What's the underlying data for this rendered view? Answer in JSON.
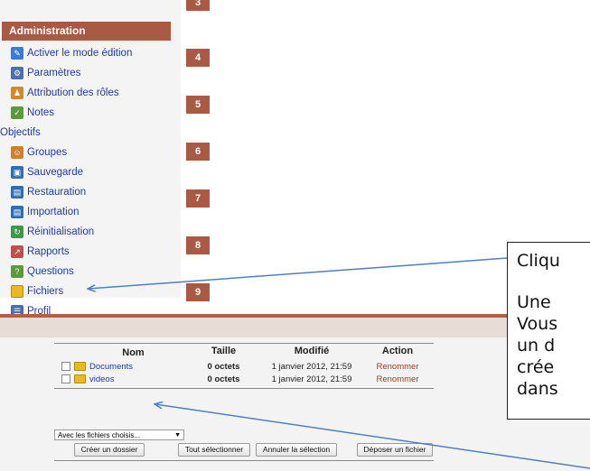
{
  "admin": {
    "title": "Administration",
    "items": [
      {
        "label": "Activer le mode édition",
        "icon": "edit-pencil-icon",
        "color": "#3a7bd5"
      },
      {
        "label": "Paramètres",
        "icon": "settings-icon",
        "color": "#4a6fb0"
      },
      {
        "label": "Attribution des rôles",
        "icon": "roles-icon",
        "color": "#d08a2a"
      },
      {
        "label": "Notes",
        "icon": "grades-icon",
        "color": "#5a9a3a"
      },
      {
        "label": "Objectifs",
        "icon": "",
        "color": ""
      },
      {
        "label": "Groupes",
        "icon": "groups-icon",
        "color": "#d0802a"
      },
      {
        "label": "Sauvegarde",
        "icon": "backup-icon",
        "color": "#2f6db5"
      },
      {
        "label": "Restauration",
        "icon": "restore-icon",
        "color": "#2f6db5"
      },
      {
        "label": "Importation",
        "icon": "import-icon",
        "color": "#2f6db5"
      },
      {
        "label": "Réinitialisation",
        "icon": "reset-icon",
        "color": "#3a9a4a"
      },
      {
        "label": "Rapports",
        "icon": "reports-icon",
        "color": "#c0504d"
      },
      {
        "label": "Questions",
        "icon": "questions-icon",
        "color": "#5a9a3a"
      },
      {
        "label": "Fichiers",
        "icon": "folder-icon",
        "color": "#e8b923"
      },
      {
        "label": "Profil",
        "icon": "profile-icon",
        "color": "#4a6fb0"
      }
    ]
  },
  "weeks": [
    "3",
    "4",
    "5",
    "6",
    "7",
    "8",
    "9"
  ],
  "files": {
    "headers": {
      "name": "Nom",
      "size": "Taille",
      "modified": "Modifié",
      "action": "Action"
    },
    "rows": [
      {
        "name": "Documents",
        "size": "0 octets",
        "modified": "1 janvier 2012, 21:59",
        "action": "Renommer"
      },
      {
        "name": "videos",
        "size": "0 octets",
        "modified": "1 janvier 2012, 21:59",
        "action": "Renommer"
      }
    ],
    "with_selected": "Avec les fichiers choisis...",
    "buttons": {
      "create_folder": "Créer un dossier",
      "select_all": "Tout sélectionner",
      "deselect": "Annuler la sélection",
      "upload": "Déposer un fichier"
    }
  },
  "callout": {
    "lines": [
      "Cliqu",
      "",
      "Une",
      "Vous",
      "un d",
      "crée",
      "dans"
    ]
  },
  "colors": {
    "accent": "#a85a45",
    "link": "#1f3aa8",
    "arrow": "#4f7fc0"
  }
}
